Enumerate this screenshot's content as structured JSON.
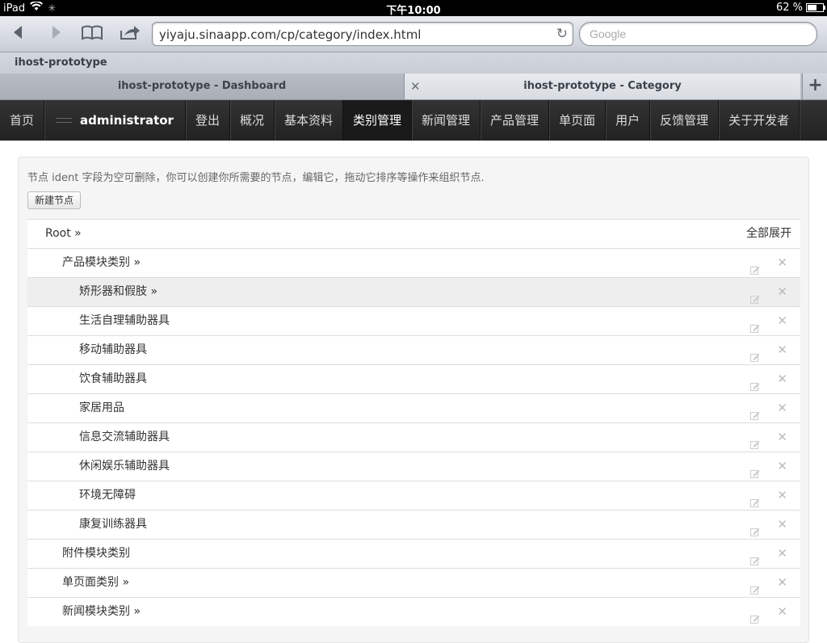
{
  "status_bar": {
    "device": "iPad",
    "time": "下午10:00",
    "battery_text": "62 %",
    "battery_level": 0.62
  },
  "browser": {
    "url": "yiyaju.sinaapp.com/cp/category/index.html",
    "search_placeholder": "Google",
    "bookmark": "ihost-prototype",
    "tabs": [
      {
        "label": "ihost-prototype - Dashboard"
      },
      {
        "label": "ihost-prototype - Category"
      }
    ]
  },
  "navbar": {
    "items": [
      "首页",
      "administrator",
      "登出",
      "概况",
      "基本资料",
      "类别管理",
      "新闻管理",
      "产品管理",
      "单页面",
      "用户",
      "反馈管理",
      "关于开发者"
    ],
    "active_index": 5
  },
  "content": {
    "intro": "节点 ident 字段为空可删除，你可以创建你所需要的节点，编辑它，拖动它排序等操作来组织节点.",
    "new_node_button": "新建节点",
    "root_label": "Root »",
    "expand_all": "全部展开",
    "nodes": [
      {
        "label": "产品模块类别 »",
        "level": 1,
        "highlight": false
      },
      {
        "label": "矫形器和假肢 »",
        "level": 2,
        "highlight": true
      },
      {
        "label": "生活自理辅助器具",
        "level": 2,
        "highlight": false
      },
      {
        "label": "移动辅助器具",
        "level": 2,
        "highlight": false
      },
      {
        "label": "饮食辅助器具",
        "level": 2,
        "highlight": false
      },
      {
        "label": "家居用品",
        "level": 2,
        "highlight": false
      },
      {
        "label": "信息交流辅助器具",
        "level": 2,
        "highlight": false
      },
      {
        "label": "休闲娱乐辅助器具",
        "level": 2,
        "highlight": false
      },
      {
        "label": "环境无障碍",
        "level": 2,
        "highlight": false
      },
      {
        "label": "康复训练器具",
        "level": 2,
        "highlight": false
      },
      {
        "label": "附件模块类别",
        "level": 1,
        "highlight": false
      },
      {
        "label": "单页面类别 »",
        "level": 1,
        "highlight": false
      },
      {
        "label": "新闻模块类别 »",
        "level": 1,
        "highlight": false
      }
    ]
  }
}
